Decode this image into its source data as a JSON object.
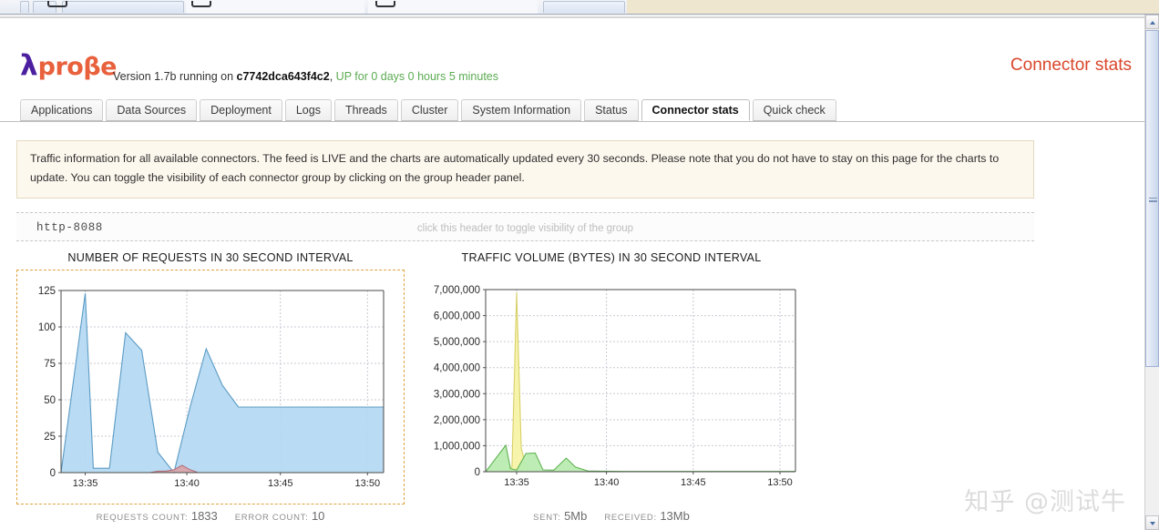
{
  "header": {
    "logo_lambda": "λ",
    "logo_text": "proβe",
    "version_prefix": "Version 1.7b running on ",
    "host": "c7742dca643f4c2",
    "version_comma": ",",
    "uptime": " UP for 0 days 0 hours 5 minutes",
    "page_title": "Connector stats",
    "accent_color": "#d9462b",
    "uptime_color": "#5bab52",
    "logo_lambda_color": "#4b1fa0",
    "logo_text_color": "#e8603c"
  },
  "tabs": [
    {
      "label": "Applications",
      "active": false
    },
    {
      "label": "Data Sources",
      "active": false
    },
    {
      "label": "Deployment",
      "active": false
    },
    {
      "label": "Logs",
      "active": false
    },
    {
      "label": "Threads",
      "active": false
    },
    {
      "label": "Cluster",
      "active": false
    },
    {
      "label": "System Information",
      "active": false
    },
    {
      "label": "Status",
      "active": false
    },
    {
      "label": "Connector stats",
      "active": true
    },
    {
      "label": "Quick check",
      "active": false
    }
  ],
  "banner": {
    "text": "Traffic information for all available connectors. The feed is LIVE and the charts are automatically updated every 30 seconds. Please note that you do not have to stay on this page for the charts to update. You can toggle the visibility of each connector group by clicking on the group header panel.",
    "background": "#fdf8ee",
    "border": "#e3d9bf"
  },
  "group": {
    "name": "http-8088",
    "toggle_hint": "click this header to toggle visibility of the group"
  },
  "chart_data": [
    {
      "type": "area",
      "title": "NUMBER OF REQUESTS IN 30 SECOND INTERVAL",
      "xlabel": "",
      "ylabel": "",
      "ylim": [
        0,
        125
      ],
      "yticks": [
        0,
        25,
        50,
        75,
        100,
        125
      ],
      "ytick_labels": [
        "0",
        "25",
        "50",
        "75",
        "100",
        "125"
      ],
      "xtick_labels": [
        "13:35",
        "13:45",
        "13:40",
        "13:50"
      ],
      "xticks_ordered": [
        "13:35",
        "13:40",
        "13:45",
        "13:50"
      ],
      "grid": true,
      "legend_position": "none",
      "series": [
        {
          "name": "requests",
          "color": "#b5d9f2",
          "line_color": "#5b9bc4",
          "x": [
            0.0,
            1.5,
            2.0,
            3.0,
            4.0,
            5.0,
            6.0,
            7.0,
            8.0,
            9.0,
            10.0,
            11.0,
            12.0,
            13.0,
            14.0,
            15.0,
            16.0,
            17.0,
            18.0,
            19.0,
            20.0
          ],
          "values": [
            0,
            123,
            3,
            3,
            96,
            84,
            14,
            0,
            45,
            85,
            60,
            45,
            45,
            45,
            45,
            45,
            45,
            45,
            45,
            45,
            45
          ]
        },
        {
          "name": "errors",
          "color": "#d9a5ab",
          "line_color": "#b3707a",
          "x": [
            5.5,
            6.0,
            6.5,
            7.0,
            7.5,
            8.0,
            8.5
          ],
          "values": [
            0,
            1,
            1,
            2,
            5,
            2,
            0
          ]
        }
      ],
      "footer": {
        "requests_count_label": "REQUESTS COUNT:",
        "requests_count_value": "1833",
        "error_count_label": "ERROR COUNT:",
        "error_count_value": "10"
      },
      "frame_border_color": "#e0a33f"
    },
    {
      "type": "area",
      "title": "TRAFFIC VOLUME (BYTES) IN 30 SECOND INTERVAL",
      "xlabel": "",
      "ylabel": "",
      "ylim": [
        0,
        7000000
      ],
      "yticks": [
        0,
        1000000,
        2000000,
        3000000,
        4000000,
        5000000,
        6000000,
        7000000
      ],
      "ytick_labels": [
        "0",
        "1,000,000",
        "2,000,000",
        "3,000,000",
        "4,000,000",
        "5,000,000",
        "6,000,000",
        "7,000,000"
      ],
      "xtick_labels": [
        "13:35",
        "13:40",
        "13:45",
        "13:50"
      ],
      "grid": true,
      "legend_position": "none",
      "series": [
        {
          "name": "received",
          "color": "#f7f3a8",
          "line_color": "#d8d06a",
          "x": [
            1.3,
            1.7,
            2.0,
            2.3,
            2.7
          ],
          "values": [
            0,
            200000,
            6900000,
            900000,
            0
          ]
        },
        {
          "name": "sent",
          "color": "#b9ecb0",
          "line_color": "#63b356",
          "x": [
            0.0,
            1.3,
            1.6,
            2.0,
            2.6,
            3.2,
            3.7,
            4.4,
            5.2,
            5.8,
            6.6,
            7.4,
            8.2,
            9.0,
            20.0
          ],
          "values": [
            0,
            1020000,
            120000,
            60000,
            700000,
            720000,
            70000,
            60000,
            520000,
            180000,
            30000,
            20000,
            15000,
            10000,
            10000
          ]
        }
      ],
      "footer": {
        "sent_label": "SENT:",
        "sent_value": "5Mb",
        "received_label": "RECEIVED:",
        "received_value": "13Mb"
      }
    }
  ],
  "watermark": {
    "text": "知乎 @测试牛"
  },
  "scrollbar": {
    "up_icon": "chevron-up-icon",
    "down_icon": "chevron-down-icon"
  }
}
